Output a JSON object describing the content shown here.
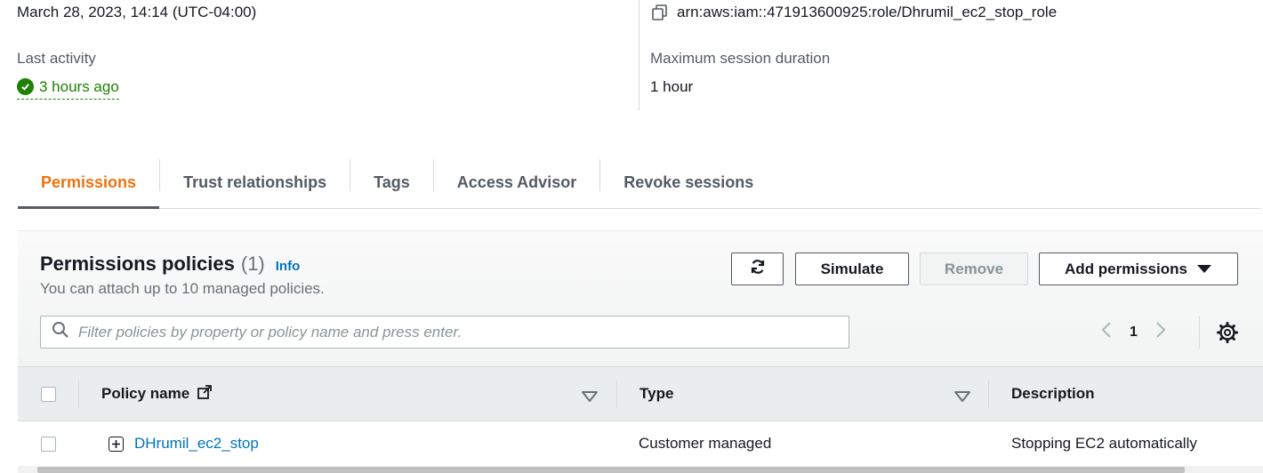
{
  "summary": {
    "creation_date": "March 28, 2023, 14:14 (UTC-04:00)",
    "last_activity_label": "Last activity",
    "last_activity_value": "3 hours ago",
    "arn": "arn:aws:iam::471913600925:role/Dhrumil_ec2_stop_role",
    "max_session_label": "Maximum session duration",
    "max_session_value": "1 hour"
  },
  "tabs": [
    {
      "label": "Permissions",
      "active": true
    },
    {
      "label": "Trust relationships"
    },
    {
      "label": "Tags"
    },
    {
      "label": "Access Advisor"
    },
    {
      "label": "Revoke sessions"
    }
  ],
  "policies": {
    "title": "Permissions policies",
    "count": "(1)",
    "info": "Info",
    "description": "You can attach up to 10 managed policies.",
    "buttons": {
      "simulate": "Simulate",
      "remove": "Remove",
      "add": "Add permissions"
    },
    "search_placeholder": "Filter policies by property or policy name and press enter.",
    "page": "1",
    "columns": {
      "policy_name": "Policy name",
      "type": "Type",
      "description": "Description"
    },
    "rows": [
      {
        "name": "DHrumil_ec2_stop",
        "type": "Customer managed",
        "description": "Stopping EC2 automatically"
      }
    ]
  },
  "colors": {
    "accent": "#ec7211",
    "link": "#0073bb",
    "success": "#1d8102"
  },
  "icons": [
    "check-circle-icon",
    "copy-icon",
    "refresh-icon",
    "caret-down-icon",
    "search-icon",
    "chevron-left-icon",
    "chevron-right-icon",
    "gear-icon",
    "external-link-icon",
    "sort-icon",
    "expand-icon"
  ]
}
